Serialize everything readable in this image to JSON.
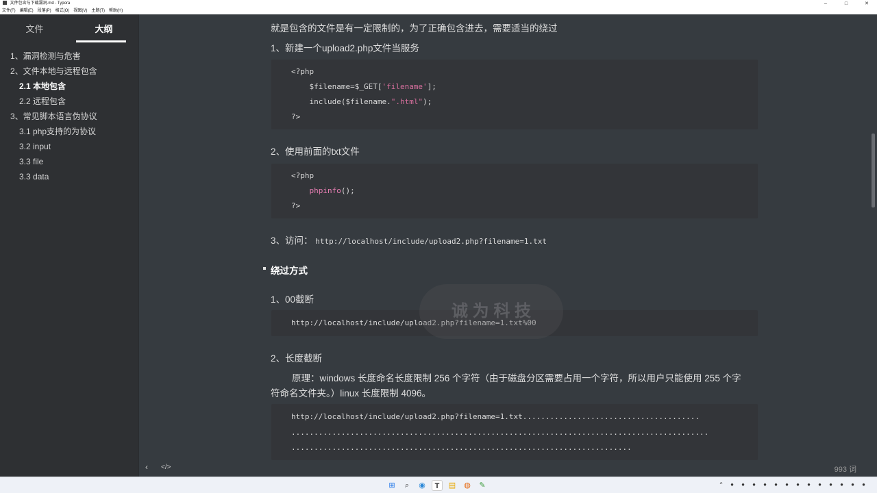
{
  "window": {
    "title": "文件包含与下载漏洞.md - Typora",
    "controls": [
      "–",
      "□",
      "✕"
    ]
  },
  "menu": [
    "文件(F)",
    "编辑(E)",
    "段落(P)",
    "格式(O)",
    "视图(V)",
    "主题(T)",
    "帮助(H)"
  ],
  "sidebar": {
    "tabs": [
      {
        "label": "文件",
        "active": false
      },
      {
        "label": "大纲",
        "active": true
      }
    ],
    "outline": [
      {
        "label": "1、漏洞检测与危害",
        "level": 1
      },
      {
        "label": "2、文件本地与远程包含",
        "level": 1
      },
      {
        "label": "2.1 本地包含",
        "level": 2,
        "active": true
      },
      {
        "label": "2.2 远程包含",
        "level": 2
      },
      {
        "label": "3、常见脚本语言伪协议",
        "level": 1
      },
      {
        "label": "3.1 php支持的为协议",
        "level": 2
      },
      {
        "label": "3.2 input",
        "level": 2
      },
      {
        "label": "3.3 file",
        "level": 2
      },
      {
        "label": "3.3 data",
        "level": 2
      }
    ]
  },
  "footer": {
    "back_icon": "‹",
    "source_icon": "</>",
    "word_count": "993 词"
  },
  "doc": {
    "intro": "就是包含的文件是有一定限制的，为了正确包含进去，需要适当的绕过",
    "step1": "1、新建一个upload2.php文件当服务",
    "code1": {
      "l1": "<?php",
      "l2a": "    $filename=$_GET[",
      "l2b": "'filename'",
      "l2c": "];",
      "l3a": "    include($filename.",
      "l3b": "\".html\"",
      "l3c": ");",
      "l4": "?>"
    },
    "step2": "2、使用前面的txt文件",
    "code2": {
      "l1": "<?php",
      "l2a": "    phpinfo",
      "l2b": "();",
      "l3": "?>"
    },
    "step3_label": "3、访问：",
    "step3_url": "http://localhost/include/upload2.php?filename=1.txt",
    "bypass_heading": "绕过方式",
    "bypass1": "1、00截断",
    "code3": "http://localhost/include/upload2.php?filename=1.txt%00",
    "bypass2": "2、长度截断",
    "principle_l1": "原理：windows 长度命名长度限制 256 个字符（由于磁盘分区需要占用一个字符，所以用户只能使用 255 个字",
    "principle_l2": "符命名文件夹。）linux 长度限制 4096。",
    "code4": {
      "l1": "http://localhost/include/upload2.php?filename=1.txt.......................................",
      "l2": "............................................................................................",
      "l3": "..........................................................................."
    },
    "watermark": "诚 为 科 技"
  },
  "taskbar": {
    "icons": [
      "windows-start",
      "search",
      "chat",
      "typora",
      "files",
      "firefox",
      "app"
    ],
    "icon_glyphs": [
      "⊞",
      "⌕",
      "◉",
      "T",
      "▤",
      "◍",
      "✎"
    ]
  }
}
